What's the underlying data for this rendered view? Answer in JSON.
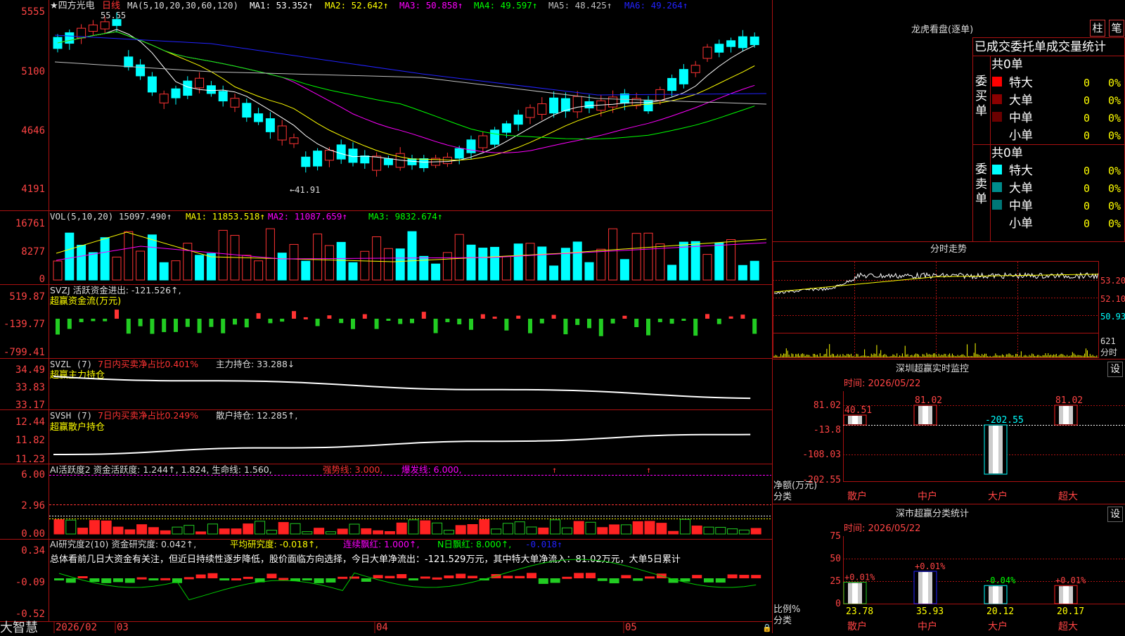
{
  "brand": "大智慧",
  "colors": {
    "up": "#ff3333",
    "down": "#00ffff",
    "frame": "#aa1111",
    "ma1": "#ffffff",
    "ma2": "#ffff00",
    "ma3": "#ff00ff",
    "ma4": "#00ff00",
    "ma5": "#c0c0c0",
    "ma6": "#2222ff"
  },
  "main_chart": {
    "stock": "★四方光电",
    "period": "日线",
    "ma_header": "MA(5,10,20,30,60,120)",
    "ma1": "MA1: 53.352↑",
    "ma2": "MA2: 52.642↑",
    "ma3": "MA3: 50.858↑",
    "ma4": "MA4: 49.597↑",
    "ma5": "MA5: 48.425↑",
    "ma6": "MA6: 49.264↑",
    "y_ticks": [
      "5555",
      "5100",
      "4646",
      "4191"
    ],
    "high_label": "55.55",
    "low_label": "←41.91"
  },
  "vol_panel": {
    "title": "VOL(5,10,20) 15097.490↑",
    "ma1": "MA1: 11853.518↑",
    "ma2": "MA2: 11087.659↑",
    "ma3": "MA3: 9832.674↑",
    "y_ticks": [
      "16761",
      "8277",
      "0"
    ]
  },
  "svzj_panel": {
    "title": "SVZJ  活跃资金进出: -121.526↑,",
    "subtitle": "超赢资金流(万元)",
    "y_ticks": [
      "519.87",
      "-139.77",
      "-799.41"
    ]
  },
  "svzl_panel": {
    "title_prefix": "SVZL (7)",
    "title_red": "7日内买卖净占比0.401%",
    "title_suffix": "主力持仓: 33.288↓",
    "subtitle": "超赢主力持仓",
    "y_ticks": [
      "34.49",
      "33.83",
      "33.17"
    ]
  },
  "svsh_panel": {
    "title_prefix": "SVSH (7)",
    "title_red": "7日内买卖净占比0.249%",
    "title_suffix": "散户持仓: 12.285↑,",
    "subtitle": "超赢散户持仓",
    "y_ticks": [
      "12.44",
      "11.82",
      "11.23"
    ]
  },
  "ai_active_panel": {
    "title": "AI活跃度2 资金活跃度: 1.244↑, 1.824, 生命线: 1.560,",
    "strong": "强势线: 3.000,",
    "burst": "爆发线: 6.000,",
    "y_ticks": [
      "6.00",
      "2.96",
      "0.00"
    ]
  },
  "ai_research_panel": {
    "title": "AI研究度2(10) 资金研究度: 0.042↑,",
    "avg": "平均研究度: -0.018↑,",
    "lianxu": "连续飘红: 1.000↑,",
    "nday": "N日飘红: 8.000↑,",
    "last": "-0.018↑",
    "comment": "总体看前几日大资金有关注，但近日持续性逐步降低，股价面临方向选择，今日大单净流出：-121.529万元，其中特大单净流入：81.02万元，大单5日累计",
    "y_ticks": [
      "0.34",
      "-0.09",
      "-0.52"
    ]
  },
  "date_axis": {
    "labels": [
      "2026/02",
      "03",
      "04",
      "05"
    ]
  },
  "dragon_tiger": {
    "title": "龙虎看盘(逐单)",
    "btn_zhu": "柱",
    "btn_bi": "笔",
    "subtitle": "已成交委托单成交量统计",
    "buy_total": "共0单",
    "buy_label": "委买单",
    "sell_total": "共0单",
    "sell_label": "委卖单",
    "buy_rows": [
      {
        "label": "特大",
        "count": "0",
        "pct": "0%",
        "color": "#ff0000"
      },
      {
        "label": "大单",
        "count": "0",
        "pct": "0%",
        "color": "#8b0000"
      },
      {
        "label": "中单",
        "count": "0",
        "pct": "0%",
        "color": "#6b0000"
      },
      {
        "label": "小单",
        "count": "0",
        "pct": "0%",
        "color": ""
      }
    ],
    "sell_rows": [
      {
        "label": "特大",
        "count": "0",
        "pct": "0%",
        "color": "#00ffff"
      },
      {
        "label": "大单",
        "count": "0",
        "pct": "0%",
        "color": "#008b8b"
      },
      {
        "label": "中单",
        "count": "0",
        "pct": "0%",
        "color": "#007777"
      },
      {
        "label": "小单",
        "count": "0",
        "pct": "0%",
        "color": ""
      }
    ]
  },
  "intraday": {
    "title": "分时走势",
    "price_ticks": [
      "53.20",
      "52.10",
      "50.93"
    ],
    "vol_tick": "621",
    "vol_unit": "分时"
  },
  "sz_monitor": {
    "title": "深圳超赢实时监控",
    "set_label": "设",
    "time": "时间: 2026/05/22",
    "y_ticks": [
      "81.02",
      "-13.8",
      "-108.03",
      "-202.55"
    ],
    "y_label_line1": "净额(万元)",
    "y_label_line2": "分类",
    "bars": [
      {
        "category": "散户",
        "value": 40.51,
        "label": "40.51"
      },
      {
        "category": "中户",
        "value": 81.02,
        "label": "81.02"
      },
      {
        "category": "大户",
        "value": -202.55,
        "label": "-202.55"
      },
      {
        "category": "超大",
        "value": 81.02,
        "label": "81.02"
      }
    ]
  },
  "sz_classify": {
    "title": "深市超赢分类统计",
    "set_label": "设",
    "time": "时间: 2026/05/22",
    "y_ticks": [
      "75",
      "50",
      "25",
      "0"
    ],
    "y_label_line1": "比例%",
    "y_label_line2": "分类",
    "bars": [
      {
        "category": "散户",
        "value": 23.78,
        "label": "23.78",
        "delta": "+0.01%",
        "color": "#22cc22"
      },
      {
        "category": "中户",
        "value": 35.93,
        "label": "35.93",
        "delta": "+0.01%",
        "color": "#2222ff"
      },
      {
        "category": "大户",
        "value": 20.12,
        "label": "20.12",
        "delta": "-0.04%",
        "color": "#00ffff"
      },
      {
        "category": "超大",
        "value": 20.17,
        "label": "20.17",
        "delta": "+0.01%",
        "color": "#ff2222"
      }
    ]
  }
}
